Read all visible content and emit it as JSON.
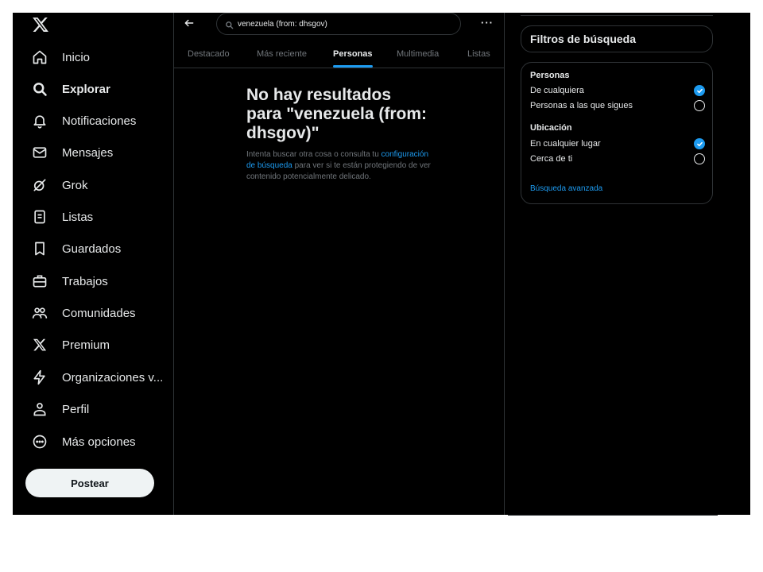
{
  "sidebar": {
    "items": [
      {
        "label": "Inicio",
        "icon": "home-icon",
        "active": false
      },
      {
        "label": "Explorar",
        "icon": "search-icon",
        "active": true
      },
      {
        "label": "Notificaciones",
        "icon": "bell-icon",
        "active": false
      },
      {
        "label": "Mensajes",
        "icon": "envelope-icon",
        "active": false
      },
      {
        "label": "Grok",
        "icon": "grok-icon",
        "active": false
      },
      {
        "label": "Listas",
        "icon": "list-icon",
        "active": false
      },
      {
        "label": "Guardados",
        "icon": "bookmark-icon",
        "active": false
      },
      {
        "label": "Trabajos",
        "icon": "briefcase-icon",
        "active": false
      },
      {
        "label": "Comunidades",
        "icon": "people-icon",
        "active": false
      },
      {
        "label": "Premium",
        "icon": "x-logo-icon",
        "active": false
      },
      {
        "label": "Organizaciones v...",
        "icon": "lightning-icon",
        "active": false
      },
      {
        "label": "Perfil",
        "icon": "person-icon",
        "active": false
      },
      {
        "label": "Más opciones",
        "icon": "more-circle-icon",
        "active": false
      }
    ],
    "post_label": "Postear"
  },
  "search": {
    "value": "venezuela (from: dhsgov)",
    "more_label": "···"
  },
  "tabs": [
    {
      "label": "Destacado",
      "active": false
    },
    {
      "label": "Más reciente",
      "active": false
    },
    {
      "label": "Personas",
      "active": true
    },
    {
      "label": "Multimedia",
      "active": false
    },
    {
      "label": "Listas",
      "active": false
    }
  ],
  "empty": {
    "title": "No hay resultados para \"venezuela (from: dhsgov)\"",
    "text_before": "Intenta buscar otra cosa o consulta tu ",
    "link": "configuración de búsqueda",
    "text_after": " para ver si te están protegiendo de ver contenido potencialmente delicado."
  },
  "filters": {
    "title": "Filtros de búsqueda",
    "people_title": "Personas",
    "people_options": [
      {
        "label": "De cualquiera",
        "checked": true
      },
      {
        "label": "Personas a las que sigues",
        "checked": false
      }
    ],
    "location_title": "Ubicación",
    "location_options": [
      {
        "label": "En cualquier lugar",
        "checked": true
      },
      {
        "label": "Cerca de ti",
        "checked": false
      }
    ],
    "advanced_label": "Búsqueda avanzada"
  },
  "colors": {
    "background": "#000000",
    "accent": "#1d9bf0",
    "text": "#e7e9ea",
    "muted": "#71767b",
    "border": "#2f3336"
  }
}
